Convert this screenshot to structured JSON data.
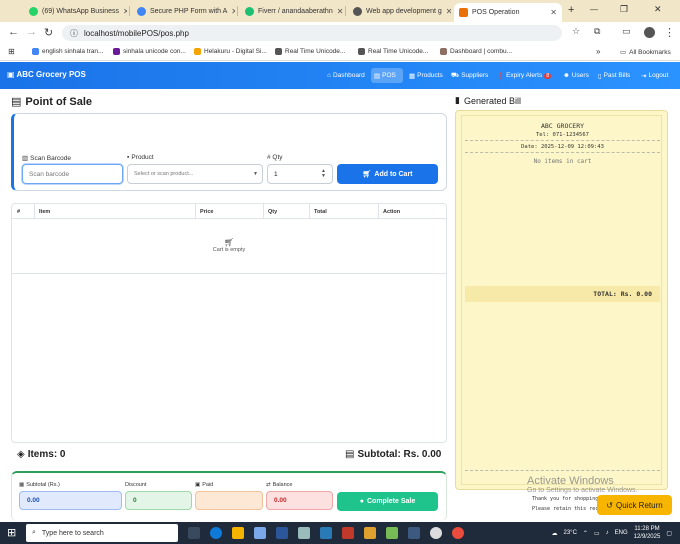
{
  "browser": {
    "tabs": [
      {
        "label": "(69) WhatsApp Business",
        "color": "#25d366"
      },
      {
        "label": "Secure PHP Form with A",
        "color": "#4285f4"
      },
      {
        "label": "Fiverr / anandaaberathn",
        "color": "#1dbf73"
      },
      {
        "label": "Web app development g",
        "color": "#555555"
      },
      {
        "label": "POS Operation",
        "color": "#e8710a"
      }
    ],
    "url": "localhost/mobilePOS/pos.php",
    "bookmarks": [
      "english sinhala tran...",
      "sinhala unicode con...",
      "Helakuru - Digital Si...",
      "Real Time Unicode...",
      "Real Time Unicode...",
      "Dashboard | combu..."
    ],
    "all_bookmarks": "All Bookmarks"
  },
  "app": {
    "brand": "ABC Grocery POS",
    "nav": [
      "Dashboard",
      "POS",
      "Products",
      "Suppliers",
      "Expiry Alerts",
      "Users",
      "Past Bills",
      "Logout"
    ],
    "expiry_badge": "8"
  },
  "pos": {
    "title": "Point of Sale",
    "scan_label": "Scan Barcode",
    "scan_placeholder": "Scan barcode",
    "product_label": "Product",
    "product_placeholder": "Select or scan product...",
    "qty_label": "# Qty",
    "qty_value": "1",
    "add_button": "Add to Cart",
    "table_headers": [
      "#",
      "Item",
      "Price",
      "Qty",
      "Total",
      "Action"
    ],
    "cart_empty": "Cart is empty",
    "items_label": "Items: 0",
    "subtotal_label": "Subtotal: Rs. 0.00"
  },
  "totals": {
    "subtotal_label": "Subtotal (Rs.)",
    "subtotal_value": "0.00",
    "discount_label": "Discount",
    "discount_value": "0",
    "paid_label": "Paid",
    "paid_value": "",
    "balance_label": "Balance",
    "balance_value": "0.00",
    "complete_button": "Complete Sale"
  },
  "bill": {
    "title": "Generated Bill",
    "store": "ABC GROCERY",
    "tel": "Tel: 071-1234567",
    "date": "Date: 2025-12-09 12:09:43",
    "empty": "No items in cart",
    "total": "TOTAL: Rs. 0.00",
    "thanks": "Thank you for shopping!",
    "retain": "Please retain this receipt"
  },
  "quick_return": "Quick Return",
  "watermark": {
    "line1": "Activate Windows",
    "line2": "Go to Settings to activate Windows."
  },
  "taskbar": {
    "search_placeholder": "Type here to search",
    "weather": "23°C",
    "lang": "ENG",
    "time": "11:28 PM",
    "date": "12/9/2025"
  }
}
